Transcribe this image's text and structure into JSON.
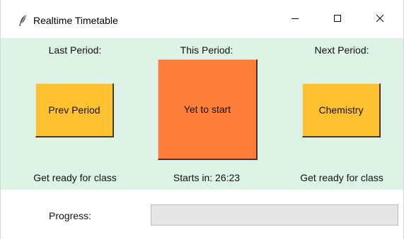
{
  "window": {
    "title": "Realtime Timetable",
    "controls": {
      "minimize_icon": "minimize-icon",
      "maximize_icon": "maximize-icon",
      "close_icon": "close-icon"
    }
  },
  "periods": {
    "last": {
      "heading": "Last Period:",
      "button_label": "Prev Period",
      "status": "Get ready for class",
      "color": "#ffc12f"
    },
    "current": {
      "heading": "This Period:",
      "button_label": "Yet to start",
      "status": "Starts in: 26:23",
      "color": "#ff7e3a"
    },
    "next": {
      "heading": "Next Period:",
      "button_label": "Chemistry",
      "status": "Get ready for class",
      "color": "#ffc12f"
    }
  },
  "progress": {
    "label": "Progress:",
    "fraction": 0
  },
  "colors": {
    "background": "#ddf3e6"
  }
}
